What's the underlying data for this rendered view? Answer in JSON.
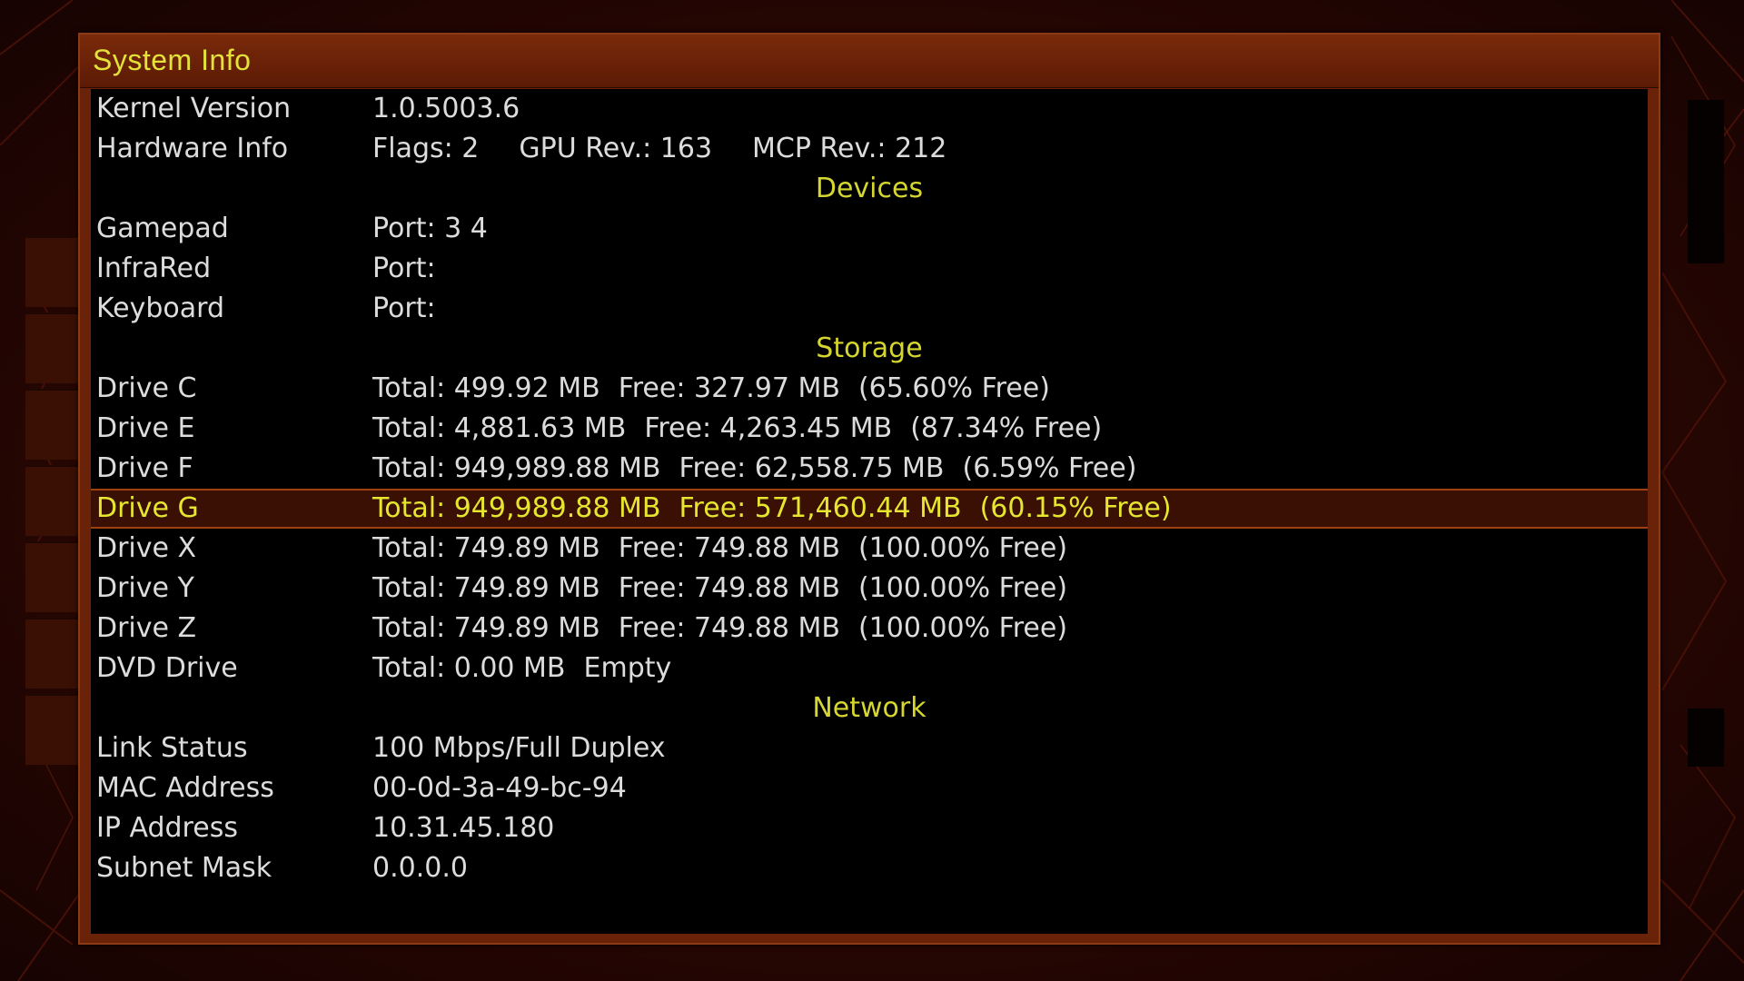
{
  "window": {
    "title": "System Info"
  },
  "system": {
    "kernel": {
      "label": "Kernel Version",
      "value": "1.0.5003.6"
    },
    "hardware": {
      "label": "Hardware Info",
      "flags": "Flags: 2",
      "gpu": "GPU Rev.: 163",
      "mcp": "MCP Rev.: 212"
    }
  },
  "devices": {
    "heading": "Devices",
    "items": [
      {
        "label": "Gamepad",
        "value": "Port: 3 4"
      },
      {
        "label": "InfraRed",
        "value": "Port:"
      },
      {
        "label": "Keyboard",
        "value": "Port:"
      }
    ]
  },
  "storage": {
    "heading": "Storage",
    "drives": [
      {
        "label": "Drive C",
        "total": "Total: 499.92 MB",
        "free": "Free: 327.97 MB",
        "pct": "(65.60% Free)"
      },
      {
        "label": "Drive E",
        "total": "Total: 4,881.63 MB",
        "free": "Free: 4,263.45 MB",
        "pct": "(87.34% Free)"
      },
      {
        "label": "Drive F",
        "total": "Total: 949,989.88 MB",
        "free": "Free: 62,558.75 MB",
        "pct": "(6.59% Free)"
      },
      {
        "label": "Drive G",
        "total": "Total: 949,989.88 MB",
        "free": "Free: 571,460.44 MB",
        "pct": "(60.15% Free)"
      },
      {
        "label": "Drive X",
        "total": "Total: 749.89 MB",
        "free": "Free: 749.88 MB",
        "pct": "(100.00% Free)"
      },
      {
        "label": "Drive Y",
        "total": "Total: 749.89 MB",
        "free": "Free: 749.88 MB",
        "pct": "(100.00% Free)"
      },
      {
        "label": "Drive Z",
        "total": "Total: 749.89 MB",
        "free": "Free: 749.88 MB",
        "pct": "(100.00% Free)"
      }
    ],
    "dvd": {
      "label": "DVD Drive",
      "total": "Total: 0.00 MB",
      "status": "Empty"
    }
  },
  "network": {
    "heading": "Network",
    "items": [
      {
        "label": "Link Status",
        "value": "100 Mbps/Full Duplex"
      },
      {
        "label": "MAC Address",
        "value": "00-0d-3a-49-bc-94"
      },
      {
        "label": "IP Address",
        "value": "10.31.45.180"
      },
      {
        "label": "Subnet Mask",
        "value": "0.0.0.0"
      }
    ]
  },
  "colors": {
    "title_text": "#e2e23a",
    "section_text": "#d6d630",
    "body_text": "#dcdcdc",
    "panel_frame": "#6a2208",
    "selection_bg": "#3a1004"
  }
}
